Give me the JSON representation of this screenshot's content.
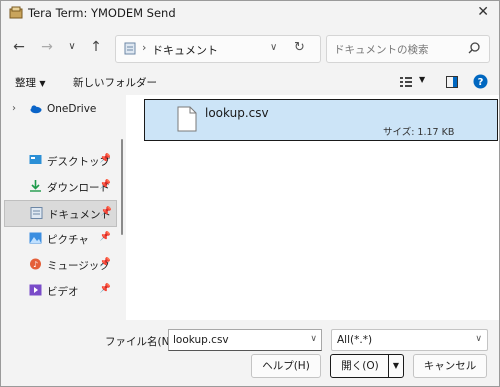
{
  "window": {
    "title": "Tera Term: YMODEM Send"
  },
  "toolbar": {
    "address_path": "ドキュメント",
    "search_placeholder": "ドキュメントの検索"
  },
  "commands": {
    "organize": "整理",
    "new_folder": "新しいフォルダー"
  },
  "sidebar": {
    "onedrive": "OneDrive",
    "items": [
      {
        "label": "デスクトップ",
        "icon": "desktop-icon"
      },
      {
        "label": "ダウンロード",
        "icon": "download-icon"
      },
      {
        "label": "ドキュメント",
        "icon": "documents-icon",
        "selected": true
      },
      {
        "label": "ピクチャ",
        "icon": "pictures-icon"
      },
      {
        "label": "ミュージック",
        "icon": "music-icon"
      },
      {
        "label": "ビデオ",
        "icon": "videos-icon"
      }
    ]
  },
  "files": [
    {
      "name": "lookup.csv",
      "size_text": "サイズ: 1.17 KB",
      "selected": true
    }
  ],
  "footer": {
    "filename_label": "ファイル名(N):",
    "filename_value": "lookup.csv",
    "filter_value": "All(*.*)",
    "help_button": "ヘルプ(H)",
    "open_button": "開く(O)",
    "cancel_button": "キャンセル"
  },
  "colors": {
    "selection": "#cce4f7",
    "accent": "#0067c0"
  }
}
